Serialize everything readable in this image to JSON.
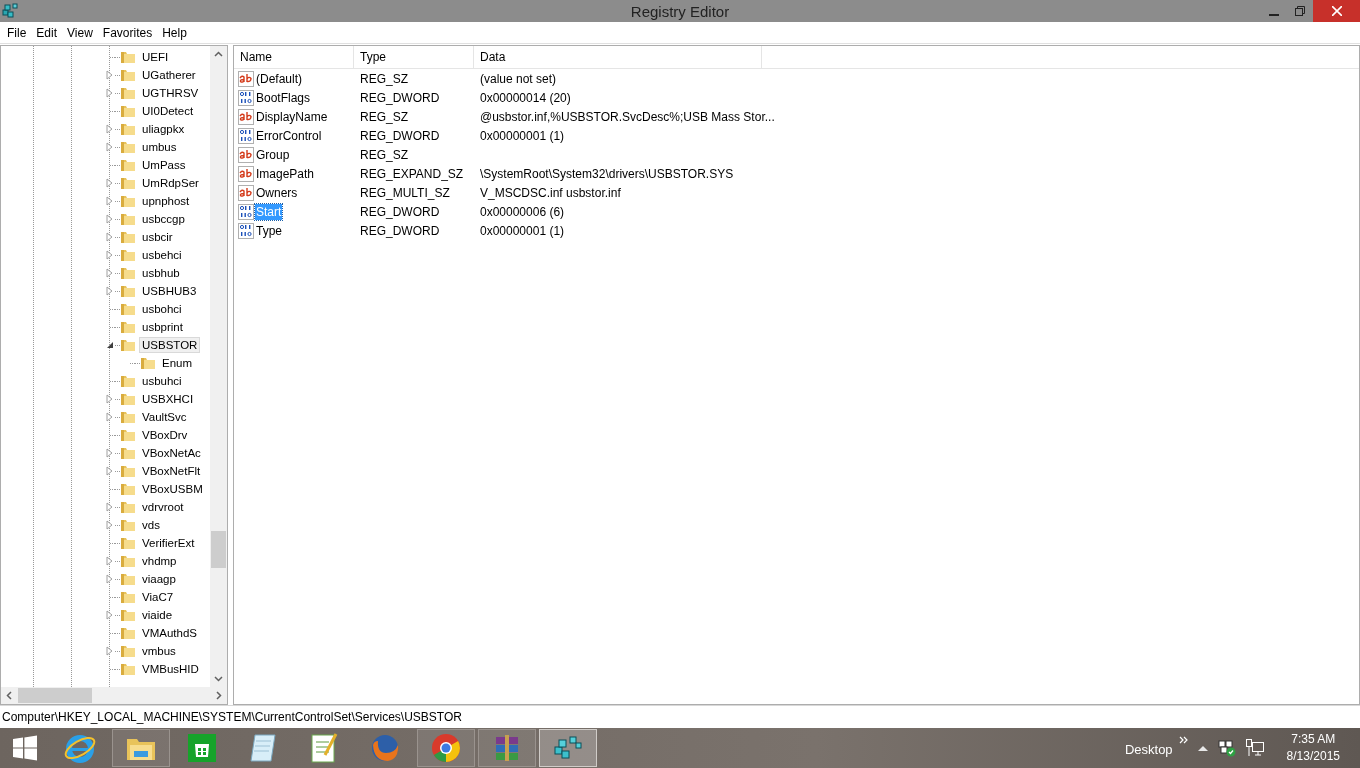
{
  "window": {
    "title": "Registry Editor"
  },
  "menu": [
    "File",
    "Edit",
    "View",
    "Favorites",
    "Help"
  ],
  "tree": [
    {
      "label": "UEFI",
      "kind": "leaf",
      "selected": false
    },
    {
      "label": "UGatherer",
      "kind": "collapsed",
      "selected": false
    },
    {
      "label": "UGTHRSV",
      "kind": "collapsed",
      "selected": false
    },
    {
      "label": "UI0Detect",
      "kind": "leaf",
      "selected": false
    },
    {
      "label": "uliagpkx",
      "kind": "collapsed",
      "selected": false
    },
    {
      "label": "umbus",
      "kind": "collapsed",
      "selected": false
    },
    {
      "label": "UmPass",
      "kind": "leaf",
      "selected": false
    },
    {
      "label": "UmRdpSer",
      "kind": "collapsed",
      "selected": false
    },
    {
      "label": "upnphost",
      "kind": "collapsed",
      "selected": false
    },
    {
      "label": "usbccgp",
      "kind": "collapsed",
      "selected": false
    },
    {
      "label": "usbcir",
      "kind": "collapsed",
      "selected": false
    },
    {
      "label": "usbehci",
      "kind": "collapsed",
      "selected": false
    },
    {
      "label": "usbhub",
      "kind": "collapsed",
      "selected": false
    },
    {
      "label": "USBHUB3",
      "kind": "collapsed",
      "selected": false
    },
    {
      "label": "usbohci",
      "kind": "leaf",
      "selected": false
    },
    {
      "label": "usbprint",
      "kind": "leaf",
      "selected": false
    },
    {
      "label": "USBSTOR",
      "kind": "expanded",
      "selected": true,
      "children": [
        {
          "label": "Enum",
          "kind": "leaf",
          "selected": false
        }
      ]
    },
    {
      "label": "usbuhci",
      "kind": "leaf",
      "selected": false
    },
    {
      "label": "USBXHCI",
      "kind": "collapsed",
      "selected": false
    },
    {
      "label": "VaultSvc",
      "kind": "collapsed",
      "selected": false
    },
    {
      "label": "VBoxDrv",
      "kind": "leaf",
      "selected": false
    },
    {
      "label": "VBoxNetAc",
      "kind": "collapsed",
      "selected": false
    },
    {
      "label": "VBoxNetFlt",
      "kind": "collapsed",
      "selected": false
    },
    {
      "label": "VBoxUSBM",
      "kind": "leaf",
      "selected": false
    },
    {
      "label": "vdrvroot",
      "kind": "collapsed",
      "selected": false
    },
    {
      "label": "vds",
      "kind": "collapsed",
      "selected": false
    },
    {
      "label": "VerifierExt",
      "kind": "leaf",
      "selected": false
    },
    {
      "label": "vhdmp",
      "kind": "collapsed",
      "selected": false
    },
    {
      "label": "viaagp",
      "kind": "collapsed",
      "selected": false
    },
    {
      "label": "ViaC7",
      "kind": "leaf",
      "selected": false
    },
    {
      "label": "viaide",
      "kind": "collapsed",
      "selected": false
    },
    {
      "label": "VMAuthdS",
      "kind": "leaf",
      "selected": false
    },
    {
      "label": "vmbus",
      "kind": "collapsed",
      "selected": false
    },
    {
      "label": "VMBusHID",
      "kind": "leaf",
      "selected": false
    }
  ],
  "table": {
    "columns": [
      "Name",
      "Type",
      "Data"
    ],
    "rows": [
      {
        "kind": "string",
        "name": "(Default)",
        "type": "REG_SZ",
        "data": "(value not set)",
        "selected": false
      },
      {
        "kind": "binary",
        "name": "BootFlags",
        "type": "REG_DWORD",
        "data": "0x00000014 (20)",
        "selected": false
      },
      {
        "kind": "string",
        "name": "DisplayName",
        "type": "REG_SZ",
        "data": "@usbstor.inf,%USBSTOR.SvcDesc%;USB Mass Stor...",
        "selected": false
      },
      {
        "kind": "binary",
        "name": "ErrorControl",
        "type": "REG_DWORD",
        "data": "0x00000001 (1)",
        "selected": false
      },
      {
        "kind": "string",
        "name": "Group",
        "type": "REG_SZ",
        "data": "",
        "selected": false
      },
      {
        "kind": "string",
        "name": "ImagePath",
        "type": "REG_EXPAND_SZ",
        "data": "\\SystemRoot\\System32\\drivers\\USBSTOR.SYS",
        "selected": false
      },
      {
        "kind": "string",
        "name": "Owners",
        "type": "REG_MULTI_SZ",
        "data": "V_MSCDSC.inf usbstor.inf",
        "selected": false
      },
      {
        "kind": "binary",
        "name": "Start",
        "type": "REG_DWORD",
        "data": "0x00000006 (6)",
        "selected": true
      },
      {
        "kind": "binary",
        "name": "Type",
        "type": "REG_DWORD",
        "data": "0x00000001 (1)",
        "selected": false
      }
    ]
  },
  "status_bar": "Computer\\HKEY_LOCAL_MACHINE\\SYSTEM\\CurrentControlSet\\Services\\USBSTOR",
  "taskbar": {
    "apps": [
      {
        "kind": "ie",
        "running": false,
        "selected": false
      },
      {
        "kind": "explorer",
        "running": true,
        "selected": false
      },
      {
        "kind": "store",
        "running": false,
        "selected": false
      },
      {
        "kind": "notepad",
        "running": false,
        "selected": false
      },
      {
        "kind": "notepadpp",
        "running": false,
        "selected": false
      },
      {
        "kind": "firefox",
        "running": false,
        "selected": false
      },
      {
        "kind": "chrome",
        "running": true,
        "selected": false
      },
      {
        "kind": "winrar",
        "running": true,
        "selected": false
      },
      {
        "kind": "regedit",
        "running": true,
        "selected": true
      }
    ],
    "toolbar": "Desktop",
    "time": "7:35 AM",
    "date": "8/13/2015"
  }
}
